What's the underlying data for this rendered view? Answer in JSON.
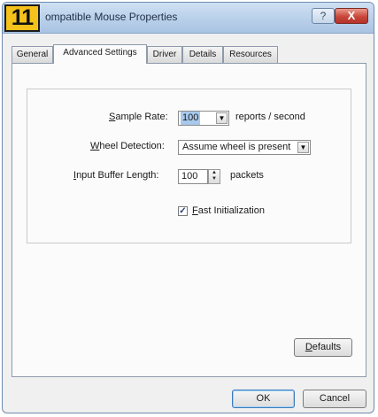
{
  "step_badge": "11",
  "window": {
    "title": "ompatible Mouse Properties",
    "help_icon": "question-icon",
    "close_icon": "close-icon",
    "help_glyph": "?",
    "close_glyph": "X"
  },
  "tabs": [
    {
      "label": "General"
    },
    {
      "label": "Advanced Settings"
    },
    {
      "label": "Driver"
    },
    {
      "label": "Details"
    },
    {
      "label": "Resources"
    }
  ],
  "settings": {
    "sample_rate": {
      "label_first": "S",
      "label_rest": "ample Rate:",
      "value": "100",
      "unit": "reports / second"
    },
    "wheel_detection": {
      "label_first": "W",
      "label_rest": "heel Detection:",
      "value": "Assume wheel is present"
    },
    "input_buffer": {
      "label_first": "I",
      "label_rest": "nput Buffer Length:",
      "value": "100",
      "unit": "packets"
    },
    "fast_init": {
      "label_first": "F",
      "label_rest": "ast Initialization",
      "checked": true
    }
  },
  "buttons": {
    "defaults_first": "D",
    "defaults_rest": "efaults",
    "ok": "OK",
    "cancel": "Cancel"
  },
  "glyphs": {
    "dropdown": "▼",
    "spin_up": "▲",
    "spin_down": "▼",
    "check": "✓"
  }
}
